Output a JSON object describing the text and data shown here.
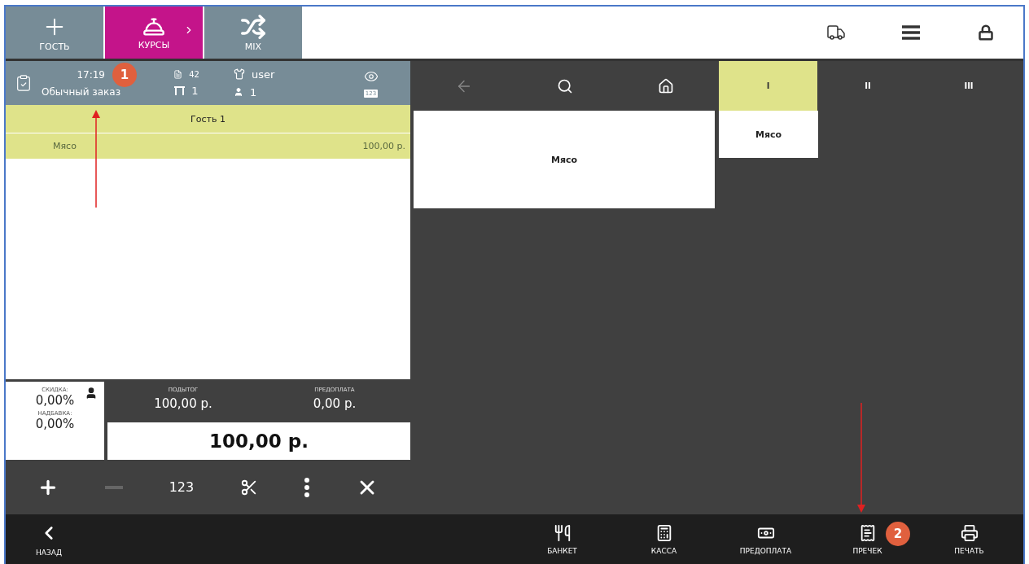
{
  "top_tabs": [
    {
      "label": "ГОСТЬ",
      "kind": "plus",
      "selected": false
    },
    {
      "label": "КУРСЫ",
      "kind": "courses",
      "selected": true
    },
    {
      "label": "MIX",
      "kind": "mix",
      "selected": false
    }
  ],
  "order_header": {
    "time": "17:19",
    "order_type": "Обычный заказ",
    "number": "42",
    "table": "1",
    "user": "user",
    "guests": "1",
    "numpad_label": "123"
  },
  "guest": {
    "label": "Гость 1",
    "items": [
      {
        "name": "Мясо",
        "price": "100,00 р.",
        "selected": true
      }
    ]
  },
  "totals": {
    "discount_label": "СКИДКА:",
    "discount": "0,00%",
    "markup_label": "НАДБАВКА:",
    "markup": "0,00%",
    "subtotal_label": "ПОДЫТОГ",
    "subtotal": "100,00 р.",
    "prepay_label": "ПРЕДОПЛАТА",
    "prepay": "0,00 р.",
    "total": "100,00 р."
  },
  "toolbar": [
    {
      "kind": "plus",
      "disabled": false
    },
    {
      "kind": "minus",
      "disabled": true
    },
    {
      "kind": "text",
      "label": "123",
      "disabled": false
    },
    {
      "kind": "scissors",
      "disabled": false
    },
    {
      "kind": "more",
      "disabled": false
    },
    {
      "kind": "close",
      "disabled": false
    }
  ],
  "nav": {
    "back_disabled": true
  },
  "course_tabs": [
    {
      "label": "I",
      "selected": true
    },
    {
      "label": "II",
      "selected": false
    },
    {
      "label": "III",
      "selected": false
    }
  ],
  "products": [
    {
      "name": "Мясо"
    }
  ],
  "course_items": [
    {
      "name": "Мясо"
    }
  ],
  "bottom_bar": {
    "back": "НАЗАД",
    "actions": [
      {
        "kind": "banquet",
        "label": "БАНКЕТ"
      },
      {
        "kind": "cash",
        "label": "КАССА"
      },
      {
        "kind": "prepay",
        "label": "ПРЕДОПЛАТА"
      },
      {
        "kind": "precheck",
        "label": "ПРЕЧЕК"
      },
      {
        "kind": "print",
        "label": "ПЕЧАТЬ"
      }
    ]
  },
  "annotations": [
    {
      "label": "1"
    },
    {
      "label": "2"
    }
  ]
}
